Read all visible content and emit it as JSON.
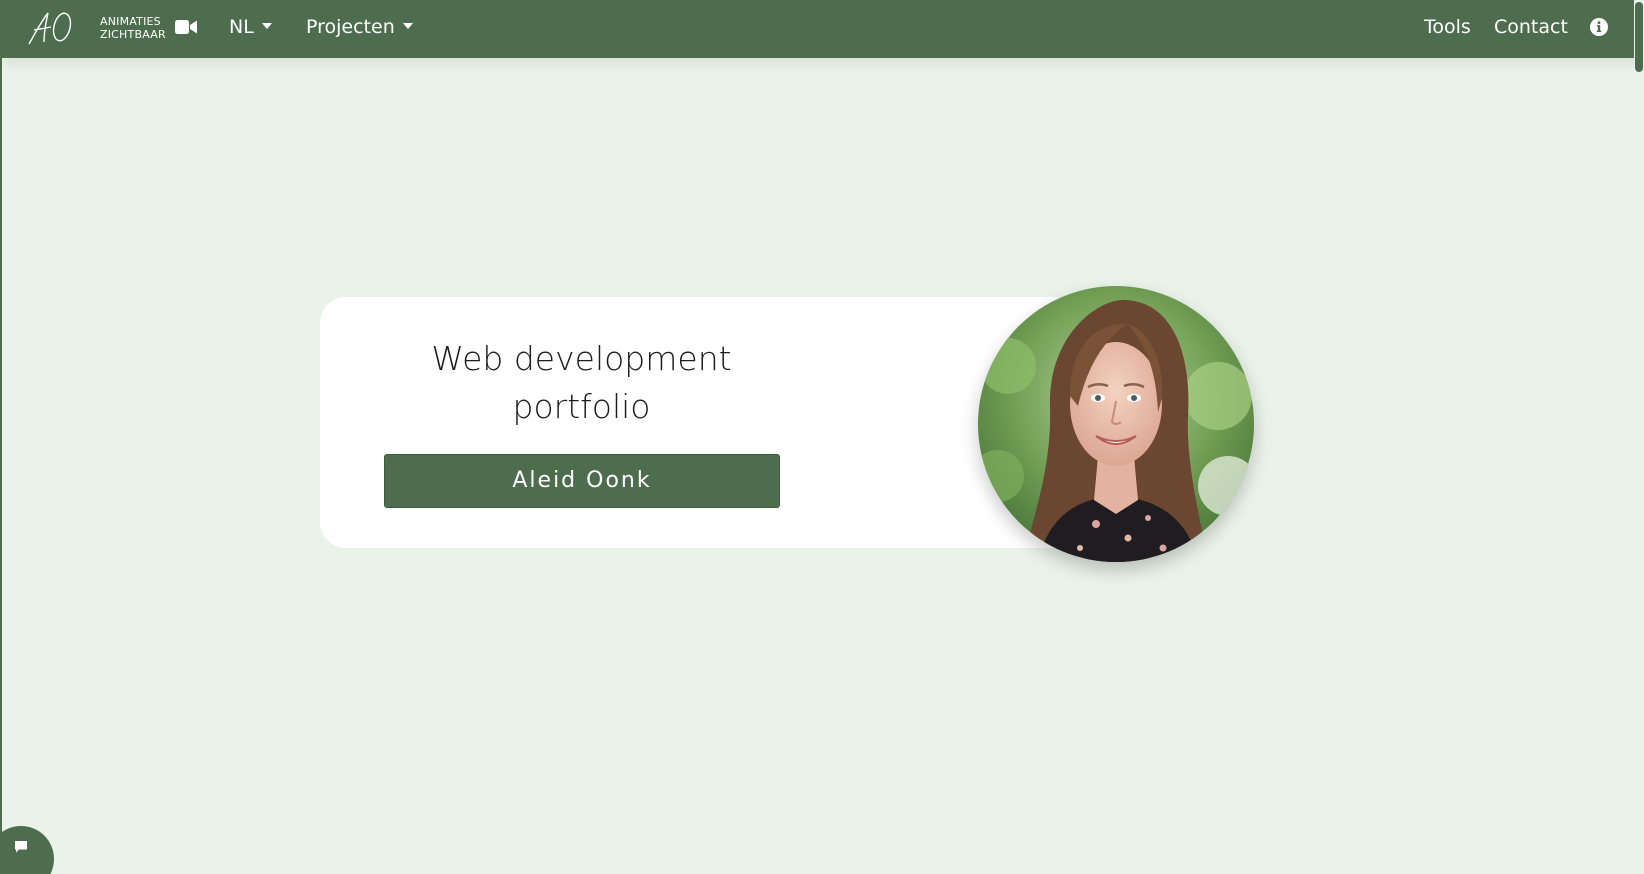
{
  "brand": {
    "logo_alt": "AO",
    "line1": "ANIMATIES",
    "line2": "ZICHTBAAR",
    "camera_icon": "video-camera-icon"
  },
  "nav": {
    "language": "NL",
    "projects": "Projecten",
    "tools": "Tools",
    "contact": "Contact",
    "info_icon": "info-circle-icon"
  },
  "hero": {
    "title_line1": "Web development",
    "title_line2": "portfolio",
    "button_label": "Aleid Oonk",
    "portrait_alt": "Portrait photo"
  },
  "chat": {
    "icon": "chat-bubble-icon"
  },
  "colors": {
    "primary": "#4d6d4e",
    "background": "#eaf3ea",
    "card": "#ffffff"
  }
}
